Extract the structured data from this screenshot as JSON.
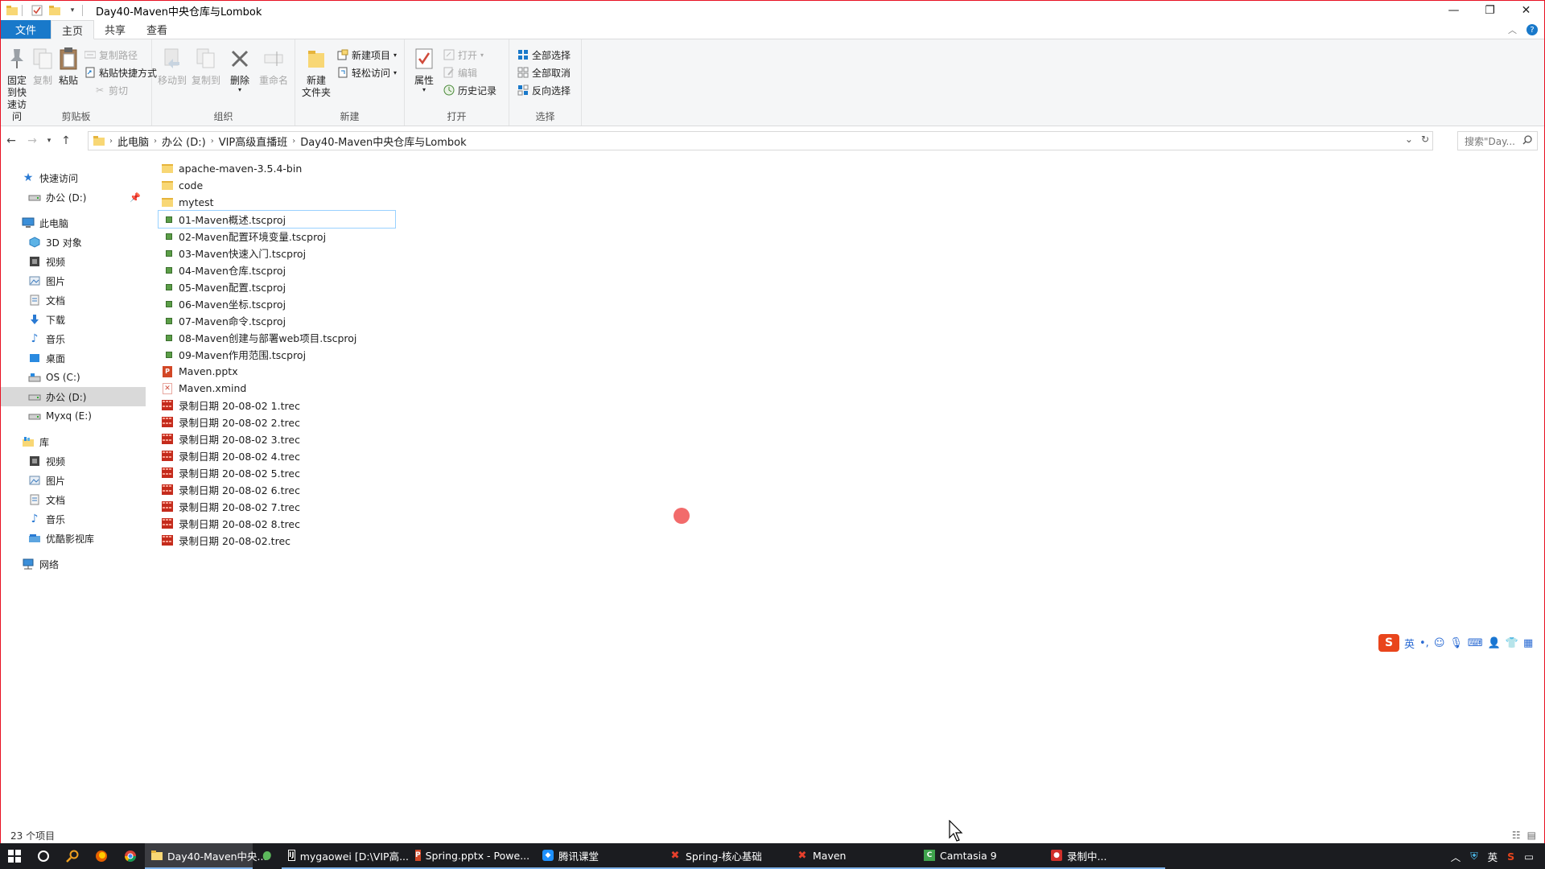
{
  "window": {
    "title": "Day40-Maven中央仓库与Lombok"
  },
  "ribbon_tabs": [
    "文件",
    "主页",
    "共享",
    "查看"
  ],
  "ribbon": {
    "clipboard": {
      "pin_label": "固定到快\n速访问",
      "copy_label": "复制",
      "paste_label": "粘贴",
      "copy_path_label": "复制路径",
      "paste_shortcut_label": "粘贴快捷方式",
      "cut_label": "剪切",
      "group_label": "剪贴板"
    },
    "organize": {
      "move_to_label": "移动到",
      "copy_to_label": "复制到",
      "delete_label": "删除",
      "rename_label": "重命名",
      "group_label": "组织"
    },
    "new": {
      "new_folder_label": "新建\n文件夹",
      "new_item_label": "新建项目",
      "easy_access_label": "轻松访问",
      "group_label": "新建"
    },
    "open": {
      "properties_label": "属性",
      "open_label": "打开",
      "edit_label": "编辑",
      "history_label": "历史记录",
      "group_label": "打开"
    },
    "select": {
      "select_all_label": "全部选择",
      "select_none_label": "全部取消",
      "invert_label": "反向选择",
      "group_label": "选择"
    }
  },
  "address": {
    "crumbs": [
      "此电脑",
      "办公 (D:)",
      "VIP高级直播班",
      "Day40-Maven中央仓库与Lombok"
    ],
    "search_placeholder": "搜索\"Day..."
  },
  "nav": {
    "quick_access": "快速访问",
    "quick_d": "办公 (D:)",
    "this_pc": "此电脑",
    "pc_items": [
      "3D 对象",
      "视频",
      "图片",
      "文档",
      "下载",
      "音乐",
      "桌面",
      "OS (C:)",
      "办公 (D:)",
      "Myxq (E:)"
    ],
    "library": "库",
    "lib_items": [
      "视频",
      "图片",
      "文档",
      "音乐",
      "优酷影视库"
    ],
    "network": "网络"
  },
  "files": [
    {
      "name": "apache-maven-3.5.4-bin",
      "type": "folder"
    },
    {
      "name": "code",
      "type": "folder"
    },
    {
      "name": "mytest",
      "type": "folder"
    },
    {
      "name": "01-Maven概述.tscproj",
      "type": "tscproj"
    },
    {
      "name": "02-Maven配置环境变量.tscproj",
      "type": "tscproj"
    },
    {
      "name": "03-Maven快速入门.tscproj",
      "type": "tscproj"
    },
    {
      "name": "04-Maven仓库.tscproj",
      "type": "tscproj"
    },
    {
      "name": "05-Maven配置.tscproj",
      "type": "tscproj"
    },
    {
      "name": "06-Maven坐标.tscproj",
      "type": "tscproj"
    },
    {
      "name": "07-Maven命令.tscproj",
      "type": "tscproj"
    },
    {
      "name": "08-Maven创建与部署web项目.tscproj",
      "type": "tscproj"
    },
    {
      "name": "09-Maven作用范围.tscproj",
      "type": "tscproj"
    },
    {
      "name": "Maven.pptx",
      "type": "pptx"
    },
    {
      "name": "Maven.xmind",
      "type": "xmind"
    },
    {
      "name": "录制日期 20-08-02 1.trec",
      "type": "trec"
    },
    {
      "name": "录制日期 20-08-02 2.trec",
      "type": "trec"
    },
    {
      "name": "录制日期 20-08-02 3.trec",
      "type": "trec"
    },
    {
      "name": "录制日期 20-08-02 4.trec",
      "type": "trec"
    },
    {
      "name": "录制日期 20-08-02 5.trec",
      "type": "trec"
    },
    {
      "name": "录制日期 20-08-02 6.trec",
      "type": "trec"
    },
    {
      "name": "录制日期 20-08-02 7.trec",
      "type": "trec"
    },
    {
      "name": "录制日期 20-08-02 8.trec",
      "type": "trec"
    },
    {
      "name": "录制日期 20-08-02.trec",
      "type": "trec"
    }
  ],
  "ime": {
    "logo": "S",
    "lang": "英"
  },
  "status": {
    "item_count": "23 个项目"
  },
  "taskbar": {
    "apps": [
      {
        "label": "Day40-Maven中央...",
        "icon": "folder-icon",
        "active": true
      },
      {
        "label": "mygaowei [D:\\VIP高...",
        "icon": "intellij-icon",
        "active": false
      },
      {
        "label": "Spring.pptx - Powe...",
        "icon": "powerpoint-icon",
        "active": false
      },
      {
        "label": "腾讯课堂",
        "icon": "tencent-class-icon",
        "active": false
      },
      {
        "label": "Spring-核心基础",
        "icon": "xmind-icon",
        "active": false
      },
      {
        "label": "Maven",
        "icon": "xmind-icon",
        "active": false
      },
      {
        "label": "Camtasia 9",
        "icon": "camtasia-icon",
        "active": false
      },
      {
        "label": "录制中...",
        "icon": "recording-icon",
        "active": false
      }
    ],
    "tray_lang": "英"
  },
  "colors": {
    "accent": "#1979ca",
    "window_border": "#e81123",
    "taskbar_bg": "#1b1c20"
  }
}
